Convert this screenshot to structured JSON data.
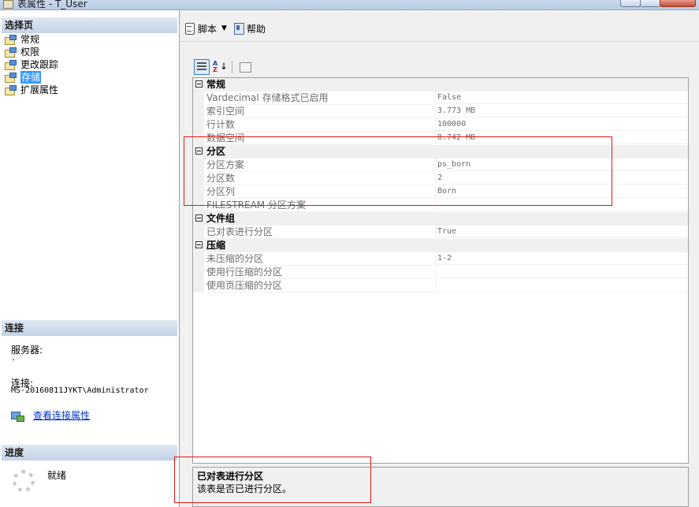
{
  "window": {
    "title": "表属性 - T_User"
  },
  "left": {
    "select_page_header": "选择页",
    "pages": [
      {
        "label": "常规",
        "selected": false
      },
      {
        "label": "权限",
        "selected": false
      },
      {
        "label": "更改跟踪",
        "selected": false
      },
      {
        "label": "存储",
        "selected": true
      },
      {
        "label": "扩展属性",
        "selected": false
      }
    ],
    "connection_header": "连接",
    "server_label": "服务器:",
    "server_value": ".",
    "connection_label": "连接:",
    "connection_value": "MS-20160811JYKT\\Administrator",
    "view_connection_link": "查看连接属性",
    "progress_header": "进度",
    "progress_status": "就绪"
  },
  "toolbar": {
    "script_label": "脚本",
    "help_label": "帮助"
  },
  "grid": {
    "categories": [
      {
        "label": "常规",
        "rows": [
          {
            "name": "Vardecimal 存储格式已启用",
            "value": "False"
          },
          {
            "name": "索引空间",
            "value": "3.773 MB"
          },
          {
            "name": "行计数",
            "value": "100000"
          },
          {
            "name": "数据空间",
            "value": "8.742 MB"
          }
        ]
      },
      {
        "label": "分区",
        "rows": [
          {
            "name": "分区方案",
            "value": "ps_born"
          },
          {
            "name": "分区数",
            "value": "2"
          },
          {
            "name": "分区列",
            "value": "Born"
          },
          {
            "name": "FILESTREAM 分区方案",
            "value": ""
          }
        ]
      },
      {
        "label": "文件组",
        "rows": [
          {
            "name": "已对表进行分区",
            "value": "True"
          }
        ]
      },
      {
        "label": "压缩",
        "rows": [
          {
            "name": "未压缩的分区",
            "value": "1-2"
          },
          {
            "name": "使用行压缩的分区",
            "value": ""
          },
          {
            "name": "使用页压缩的分区",
            "value": ""
          }
        ]
      }
    ]
  },
  "description": {
    "title": "已对表进行分区",
    "text": "该表是否已进行分区。"
  }
}
